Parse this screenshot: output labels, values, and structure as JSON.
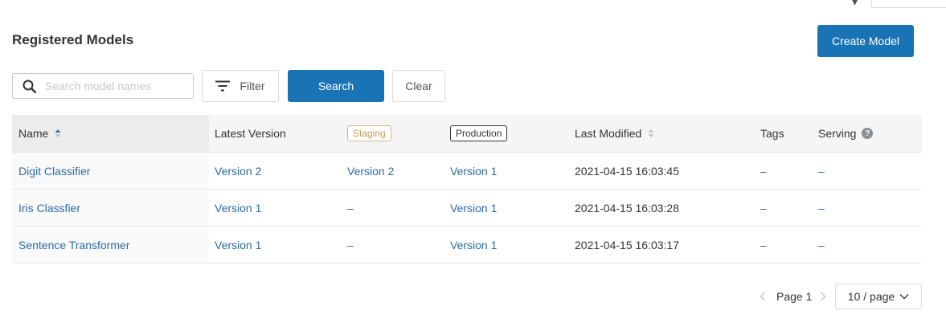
{
  "header": {
    "title": "Registered Models",
    "create_button": "Create Model"
  },
  "toolbar": {
    "search_placeholder": "Search model names",
    "search_value": "",
    "filter_label": "Filter",
    "search_button": "Search",
    "clear_button": "Clear"
  },
  "table": {
    "columns": {
      "name": "Name",
      "latest_version": "Latest Version",
      "staging": "Staging",
      "production": "Production",
      "last_modified": "Last Modified",
      "tags": "Tags",
      "serving": "Serving"
    },
    "rows": [
      {
        "name": "Digit Classifier",
        "latest_version": "Version 2",
        "staging": "Version 2",
        "production": "Version 1",
        "last_modified": "2021-04-15 16:03:45",
        "tags": "–",
        "serving": "–"
      },
      {
        "name": "Iris Classfier",
        "latest_version": "Version 1",
        "staging": "–",
        "production": "Version 1",
        "last_modified": "2021-04-15 16:03:28",
        "tags": "–",
        "serving": "–"
      },
      {
        "name": "Sentence Transformer",
        "latest_version": "Version 1",
        "staging": "–",
        "production": "Version 1",
        "last_modified": "2021-04-15 16:03:17",
        "tags": "–",
        "serving": "–"
      }
    ]
  },
  "pagination": {
    "page_label": "Page 1",
    "page_size": "10 / page"
  },
  "colors": {
    "primary": "#1a73b5",
    "link": "#2b6aa0",
    "staging_tag": "#c89a5a",
    "production_tag": "#333333"
  },
  "icons": {
    "search": "search-icon",
    "filter": "filter-icon",
    "sort": "sort-icon",
    "help": "help-icon",
    "prev": "chevron-left-icon",
    "next": "chevron-right-icon",
    "dropdown": "chevron-down-icon"
  }
}
